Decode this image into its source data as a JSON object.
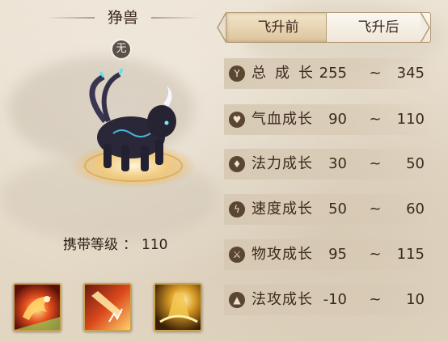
{
  "pet": {
    "name": "狰兽",
    "element_badge": "无",
    "carry_level_label": "携带等级",
    "carry_level_sep": "：",
    "carry_level_value": "110"
  },
  "tabs": [
    {
      "label": "飞升前",
      "active": true
    },
    {
      "label": "飞升后",
      "active": false
    }
  ],
  "stats": [
    {
      "label": "总成长",
      "min": "255",
      "max": "345",
      "icon": "total-growth-icon"
    },
    {
      "label": "气血成长",
      "min": "90",
      "max": "110",
      "icon": "heart-icon"
    },
    {
      "label": "法力成长",
      "min": "30",
      "max": "50",
      "icon": "mana-drop-icon"
    },
    {
      "label": "速度成长",
      "min": "50",
      "max": "60",
      "icon": "lightning-icon"
    },
    {
      "label": "物攻成长",
      "min": "95",
      "max": "115",
      "icon": "sword-icon"
    },
    {
      "label": "法攻成长",
      "min": "-10",
      "max": "10",
      "icon": "fire-icon"
    }
  ],
  "range_separator": "~",
  "skills": [
    {
      "icon": "fire-bird-skill-icon"
    },
    {
      "icon": "flame-claw-skill-icon"
    },
    {
      "icon": "golden-bell-skill-icon"
    }
  ],
  "colors": {
    "accent_gold": "#c9a24f",
    "text_dark": "#3a2a1c"
  }
}
